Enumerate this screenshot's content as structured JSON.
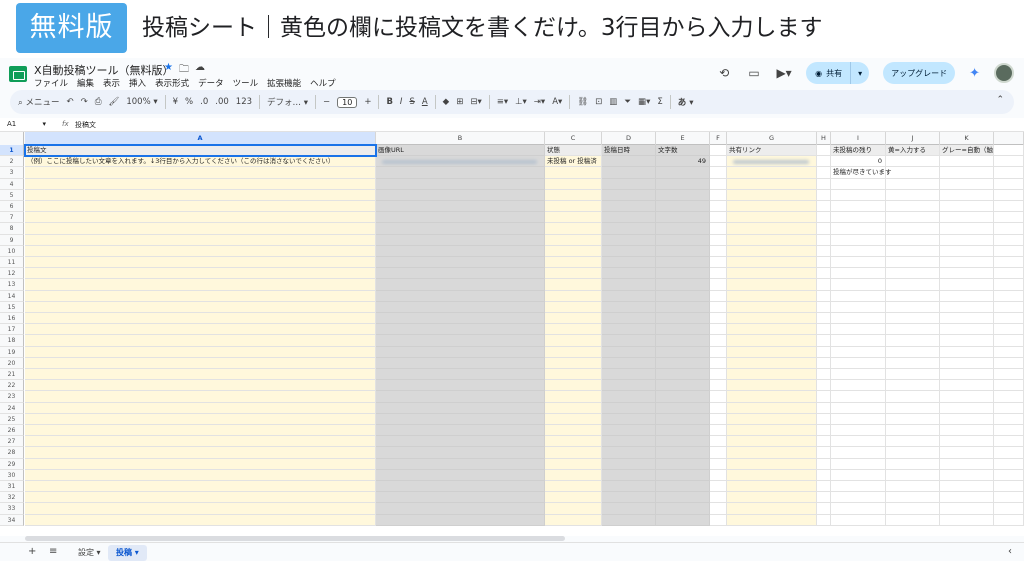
{
  "banner": {
    "badge": "無料版",
    "title": "投稿シート｜黄色の欄に投稿文を書くだけ。3行目から入力します"
  },
  "app": {
    "doc_title": "X自動投稿ツール（無料版）",
    "menu": [
      "ファイル",
      "編集",
      "表示",
      "挿入",
      "表示形式",
      "データ",
      "ツール",
      "拡張機能",
      "ヘルプ"
    ],
    "share_label": "共有",
    "upgrade_label": "アップグレード"
  },
  "toolbar": {
    "menu_label": "メニュー",
    "zoom": "100%",
    "currency": "¥",
    "percent": "%",
    "decimal_dec": ".0",
    "decimal_inc": ".00",
    "number_format": "123",
    "font": "デフォ…",
    "font_size": "10"
  },
  "formula_bar": {
    "cell_ref": "A1",
    "fx": "fx",
    "value": "投稿文"
  },
  "grid": {
    "columns": [
      "A",
      "B",
      "C",
      "D",
      "E",
      "F",
      "G",
      "H",
      "I",
      "J",
      "K"
    ],
    "header_row": [
      "投稿文",
      "画像URL",
      "状態",
      "投稿日時",
      "文字数",
      "",
      "共有リンク",
      "",
      "未投稿の残り",
      "黄=入力する",
      "グレー=自動（触らない）"
    ],
    "row2": [
      "（例）ここに投稿したい文章を入れます。↓3行目から入力してください（この行は消さないでください）",
      "",
      "未投稿 or 投稿済",
      "",
      "49",
      "",
      "",
      "",
      "0",
      "",
      ""
    ],
    "row3_i": "投稿が尽きています",
    "row_count": 34
  },
  "sheets": {
    "tabs": [
      "設定",
      "投稿"
    ],
    "active": "投稿"
  }
}
